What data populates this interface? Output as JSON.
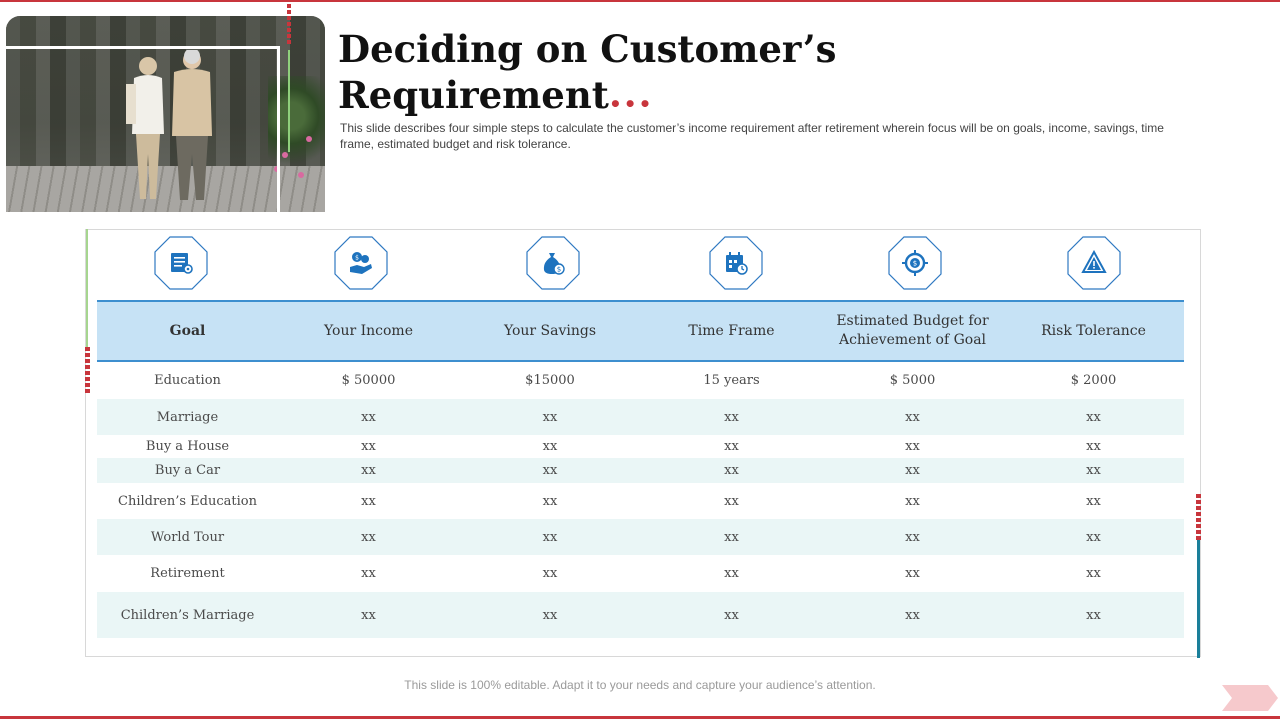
{
  "title": "Deciding on Customer’s Requirement",
  "subtitle": "This slide describes four simple steps to calculate the customer’s income requirement after retirement wherein focus will be on goals, income, savings, time frame, estimated budget and risk tolerance.",
  "footer": "This slide is 100% editable. Adapt it to your needs and capture your audience’s attention.",
  "colors": {
    "accent_red": "#c8353c",
    "header_fill": "#c6e2f5",
    "header_rule": "#3d8fcf",
    "icon_blue": "#1e73be",
    "row_alt": "#eaf6f6"
  },
  "icons": [
    "document-gear-icon",
    "money-hand-icon",
    "money-bag-icon",
    "calendar-clock-icon",
    "target-dollar-icon",
    "warning-triangle-icon"
  ],
  "table": {
    "headers": [
      "Goal",
      "Your Income",
      "Your Savings",
      "Time Frame",
      "Estimated Budget for Achievement of Goal",
      "Risk Tolerance"
    ],
    "rows": [
      [
        "Education",
        "$ 50000",
        "$15000",
        "15 years",
        "$ 5000",
        "$ 2000"
      ],
      [
        "Marriage",
        "xx",
        "xx",
        "xx",
        "xx",
        "xx"
      ],
      [
        "Buy a House",
        "xx",
        "xx",
        "xx",
        "xx",
        "xx"
      ],
      [
        "Buy a Car",
        "xx",
        "xx",
        "xx",
        "xx",
        "xx"
      ],
      [
        "Children’s Education",
        "xx",
        "xx",
        "xx",
        "xx",
        "xx"
      ],
      [
        "World Tour",
        "xx",
        "xx",
        "xx",
        "xx",
        "xx"
      ],
      [
        "Retirement",
        "xx",
        "xx",
        "xx",
        "xx",
        "xx"
      ],
      [
        "Children’s Marriage",
        "xx",
        "xx",
        "xx",
        "xx",
        "xx"
      ]
    ]
  }
}
